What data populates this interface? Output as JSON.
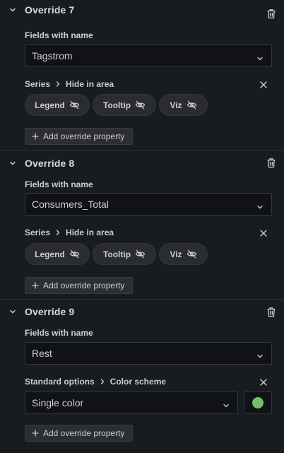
{
  "overrides": [
    {
      "title": "Override 7",
      "matcher_label": "Fields with name",
      "matcher_value": "Tagstrom",
      "property": {
        "category": "Series",
        "name": "Hide in area"
      },
      "pills": [
        "Legend",
        "Tooltip",
        "Viz"
      ],
      "add_label": "Add override property"
    },
    {
      "title": "Override 8",
      "matcher_label": "Fields with name",
      "matcher_value": "Consumers_Total",
      "property": {
        "category": "Series",
        "name": "Hide in area"
      },
      "pills": [
        "Legend",
        "Tooltip",
        "Viz"
      ],
      "add_label": "Add override property"
    },
    {
      "title": "Override 9",
      "matcher_label": "Fields with name",
      "matcher_value": "Rest",
      "property": {
        "category": "Standard options",
        "name": "Color scheme"
      },
      "color_mode": "Single color",
      "color_value": "#73bf69",
      "add_label": "Add override property"
    }
  ],
  "icons": {
    "collapse": "chevron-down-icon",
    "delete": "trash-icon",
    "remove": "close-icon",
    "hidden": "eye-slash-icon",
    "add": "plus-icon",
    "separator": "chevron-right-icon"
  }
}
